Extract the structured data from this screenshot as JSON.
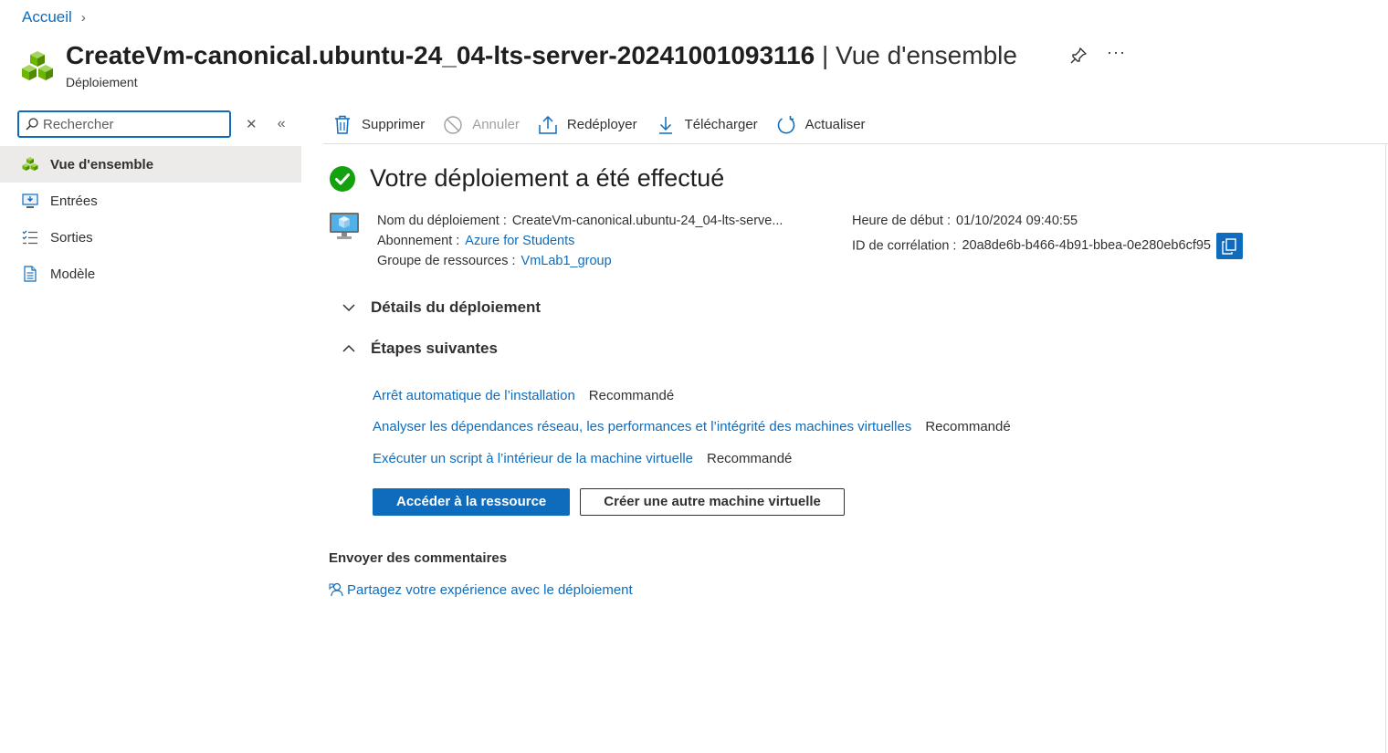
{
  "breadcrumb": {
    "home": "Accueil",
    "separator": "›"
  },
  "header": {
    "title_name": "CreateVm-canonical.ubuntu-24_04-lts-server-20241001093116",
    "title_suffix": " | Vue d'ensemble",
    "subtitle": "Déploiement",
    "more": "···"
  },
  "sidebar": {
    "search_placeholder": "Rechercher",
    "clear": "✕",
    "collapse": "«",
    "items": [
      {
        "label": "Vue d'ensemble",
        "icon": "cubes-icon",
        "active": true
      },
      {
        "label": "Entrées",
        "icon": "inputs-icon"
      },
      {
        "label": "Sorties",
        "icon": "outputs-icon"
      },
      {
        "label": "Modèle",
        "icon": "template-icon"
      }
    ]
  },
  "toolbar": {
    "delete": "Supprimer",
    "cancel": "Annuler",
    "redeploy": "Redéployer",
    "download": "Télécharger",
    "refresh": "Actualiser"
  },
  "main": {
    "status_title": "Votre déploiement a été effectué",
    "deployment_name_label": "Nom du déploiement :",
    "deployment_name_value": "CreateVm-canonical.ubuntu-24_04-lts-serve...",
    "subscription_label": "Abonnement :",
    "subscription_value": "Azure for Students",
    "resource_group_label": "Groupe de ressources :",
    "resource_group_value": "VmLab1_group",
    "start_time_label": "Heure de début :",
    "start_time_value": "01/10/2024 09:40:55",
    "correlation_label": "ID de corrélation :",
    "correlation_value": "20a8de6b-b466-4b91-bbea-0e280eb6cf95",
    "details_section": "Détails du déploiement",
    "next_steps_section": "Étapes suivantes",
    "next_steps": [
      {
        "link": "Arrêt automatique de l’installation",
        "tag": "Recommandé"
      },
      {
        "link": "Analyser les dépendances réseau, les performances et l’intégrité des machines virtuelles",
        "tag": "Recommandé"
      },
      {
        "link": "Exécuter un script à l’intérieur de la machine virtuelle",
        "tag": "Recommandé"
      }
    ],
    "go_to_resource": "Accéder à la ressource",
    "create_another": "Créer une autre machine virtuelle",
    "feedback_title": "Envoyer des commentaires",
    "feedback_link": "Partagez votre expérience avec le déploiement"
  },
  "colors": {
    "accent": "#0f6cbd",
    "success": "#13a10e",
    "cube_green": "#6bb700"
  }
}
